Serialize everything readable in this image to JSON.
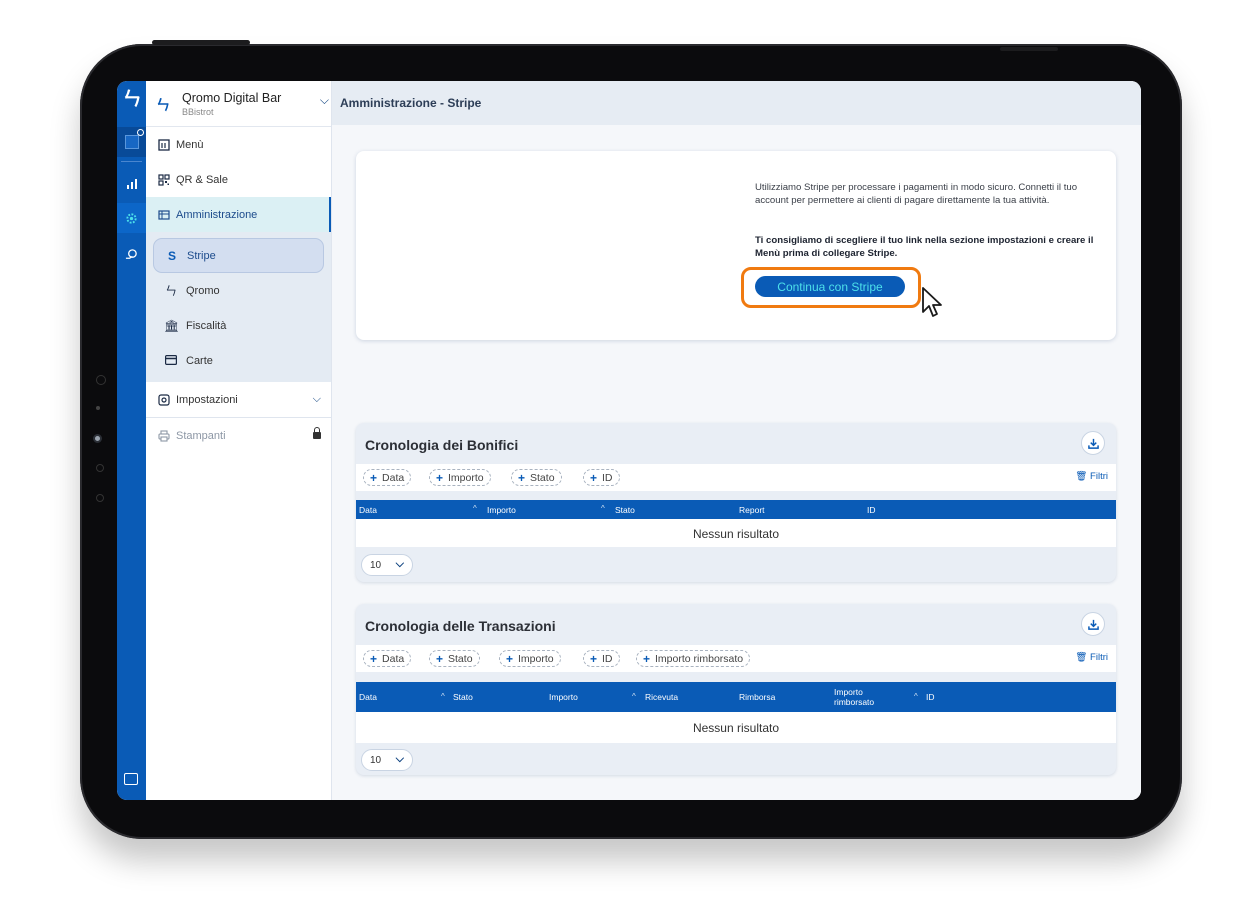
{
  "venue": {
    "name": "Qromo Digital Bar",
    "subtitle": "BBistrot"
  },
  "sidebar": {
    "items": [
      {
        "label": "Menù",
        "icon": "menu-book-icon"
      },
      {
        "label": "QR & Sale",
        "icon": "qr-code-icon"
      },
      {
        "label": "Amministrazione",
        "icon": "admin-icon"
      }
    ],
    "subitems": [
      {
        "label": "Stripe",
        "icon": "stripe-icon"
      },
      {
        "label": "Qromo",
        "icon": "qromo-icon"
      },
      {
        "label": "Fiscalità",
        "icon": "bank-icon"
      },
      {
        "label": "Carte",
        "icon": "card-icon"
      }
    ],
    "settings": {
      "label": "Impostazioni"
    },
    "printers": {
      "label": "Stampanti"
    }
  },
  "header": {
    "title": "Amministrazione - Stripe"
  },
  "stripe_card": {
    "text": "Utilizziamo Stripe per processare i pagamenti in modo sicuro. Connetti il tuo account per permettere ai clienti di pagare direttamente la tua attività.",
    "bold_text": "Ti consigliamo di scegliere il tuo link nella sezione impostazioni e creare il Menù prima di collegare Stripe.",
    "button_label": "Continua con Stripe"
  },
  "transfers": {
    "title": "Cronologia dei Bonifici",
    "filters": [
      "Data",
      "Importo",
      "Stato",
      "ID"
    ],
    "filter_link": "Filtri",
    "columns": [
      "Data",
      "Importo",
      "Stato",
      "Report",
      "ID"
    ],
    "empty": "Nessun risultato",
    "page_size": "10"
  },
  "transactions": {
    "title": "Cronologia delle Transazioni",
    "filters": [
      "Data",
      "Stato",
      "Importo",
      "ID",
      "Importo rimborsato"
    ],
    "filter_link": "Filtri",
    "columns": [
      "Data",
      "Stato",
      "Importo",
      "Ricevuta",
      "Rimborsa",
      "Importo rimborsato",
      "ID"
    ],
    "empty": "Nessun risultato",
    "page_size": "10"
  },
  "colors": {
    "primary": "#0a5bb6",
    "highlight": "#f07a10",
    "button_text": "#4ce0ea",
    "active_nav_bg": "#dbf0f4"
  }
}
